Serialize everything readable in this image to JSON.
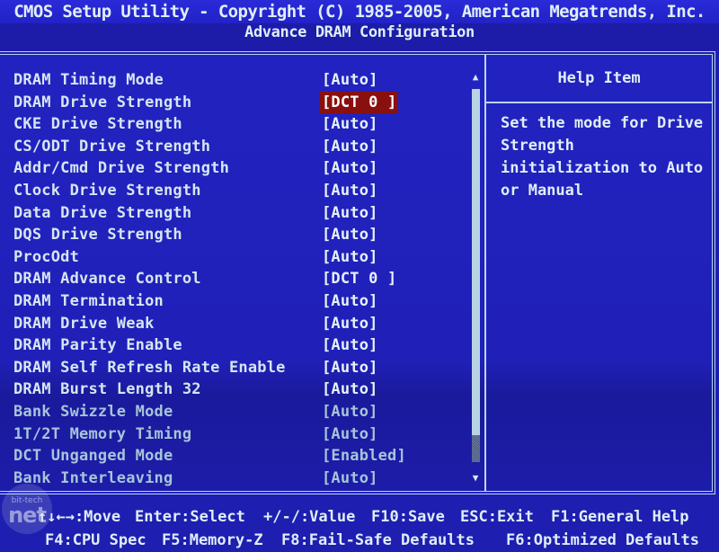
{
  "header": {
    "title": "CMOS Setup Utility - Copyright (C) 1985-2005, American Megatrends, Inc.",
    "subtitle": "Advance DRAM Configuration"
  },
  "settings": [
    {
      "label": "DRAM Timing Mode",
      "value": "[Auto]",
      "selected": false,
      "dim": false
    },
    {
      "label": "DRAM Drive Strength",
      "value": "[DCT 0 ]",
      "selected": true,
      "dim": false
    },
    {
      "label": "CKE Drive Strength",
      "value": "[Auto]",
      "selected": false,
      "dim": false
    },
    {
      "label": "CS/ODT Drive Strength",
      "value": "[Auto]",
      "selected": false,
      "dim": false
    },
    {
      "label": "Addr/Cmd Drive Strength",
      "value": "[Auto]",
      "selected": false,
      "dim": false
    },
    {
      "label": "Clock Drive Strength",
      "value": "[Auto]",
      "selected": false,
      "dim": false
    },
    {
      "label": "Data Drive Strength",
      "value": "[Auto]",
      "selected": false,
      "dim": false
    },
    {
      "label": "DQS Drive Strength",
      "value": "[Auto]",
      "selected": false,
      "dim": false
    },
    {
      "label": "ProcOdt",
      "value": "[Auto]",
      "selected": false,
      "dim": false
    },
    {
      "label": "DRAM Advance Control",
      "value": "[DCT 0 ]",
      "selected": false,
      "dim": false
    },
    {
      "label": "DRAM Termination",
      "value": "[Auto]",
      "selected": false,
      "dim": false
    },
    {
      "label": "DRAM Drive Weak",
      "value": "[Auto]",
      "selected": false,
      "dim": false
    },
    {
      "label": "DRAM Parity Enable",
      "value": "[Auto]",
      "selected": false,
      "dim": false
    },
    {
      "label": "DRAM Self Refresh Rate Enable",
      "value": "[Auto]",
      "selected": false,
      "dim": false
    },
    {
      "label": "DRAM Burst Length 32",
      "value": "[Auto]",
      "selected": false,
      "dim": false
    },
    {
      "label": "Bank Swizzle Mode",
      "value": "[Auto]",
      "selected": false,
      "dim": true
    },
    {
      "label": "1T/2T Memory Timing",
      "value": "[Auto]",
      "selected": false,
      "dim": true
    },
    {
      "label": "DCT Unganged Mode",
      "value": "[Enabled]",
      "selected": false,
      "dim": true
    },
    {
      "label": "Bank Interleaving",
      "value": "[Auto]",
      "selected": false,
      "dim": true
    }
  ],
  "scrollbar": {
    "up_icon": "▲",
    "down_icon": "▼"
  },
  "help": {
    "title": "Help Item",
    "lines": [
      "Set the mode for Drive",
      "Strength",
      "initialization to Auto",
      "or Manual"
    ]
  },
  "footer": {
    "line1": [
      {
        "text": "↑↓←→:Move"
      },
      {
        "text": "Enter:Select"
      },
      {
        "text": "+/-/:Value"
      },
      {
        "text": "F10:Save"
      },
      {
        "text": "ESC:Exit"
      },
      {
        "text": "F1:General Help"
      }
    ],
    "line2": [
      {
        "text": "F4:CPU Spec"
      },
      {
        "text": "F5:Memory-Z"
      },
      {
        "text": "F8:Fail-Safe Defaults"
      },
      {
        "text": "F6:Optimized Defaults"
      }
    ]
  },
  "watermark": {
    "top": "bit-tech",
    "main": "net"
  },
  "colors": {
    "background": "#2020b8",
    "selected_bg": "#8a1010",
    "text": "#dfeef6",
    "border": "#b8d8ec"
  }
}
